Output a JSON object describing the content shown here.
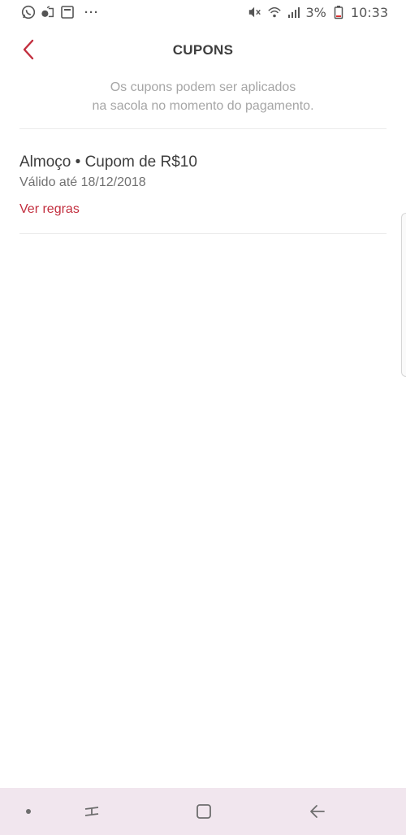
{
  "status_bar": {
    "left_icons": [
      "whatsapp-icon",
      "app-icon",
      "gallery-icon"
    ],
    "more": "···",
    "battery_percent": "3%",
    "time": "10:33"
  },
  "header": {
    "back_icon": "chevron-left-icon",
    "title": "CUPONS"
  },
  "subtitle": {
    "line1": "Os cupons podem ser aplicados",
    "line2": "na sacola no momento do pagamento."
  },
  "coupons": [
    {
      "title": "Almoço • Cupom de R$10",
      "valid": "Válido até 18/12/2018",
      "rules_label": "Ver regras"
    }
  ],
  "colors": {
    "accent": "#c22e3e",
    "nav_bg": "#f1e6ee",
    "text": "#3e3e3e",
    "muted": "#a6a6a6"
  },
  "nav_bar": {
    "items": [
      "dot-icon",
      "recent-apps-icon",
      "home-icon",
      "back-arrow-icon"
    ]
  }
}
